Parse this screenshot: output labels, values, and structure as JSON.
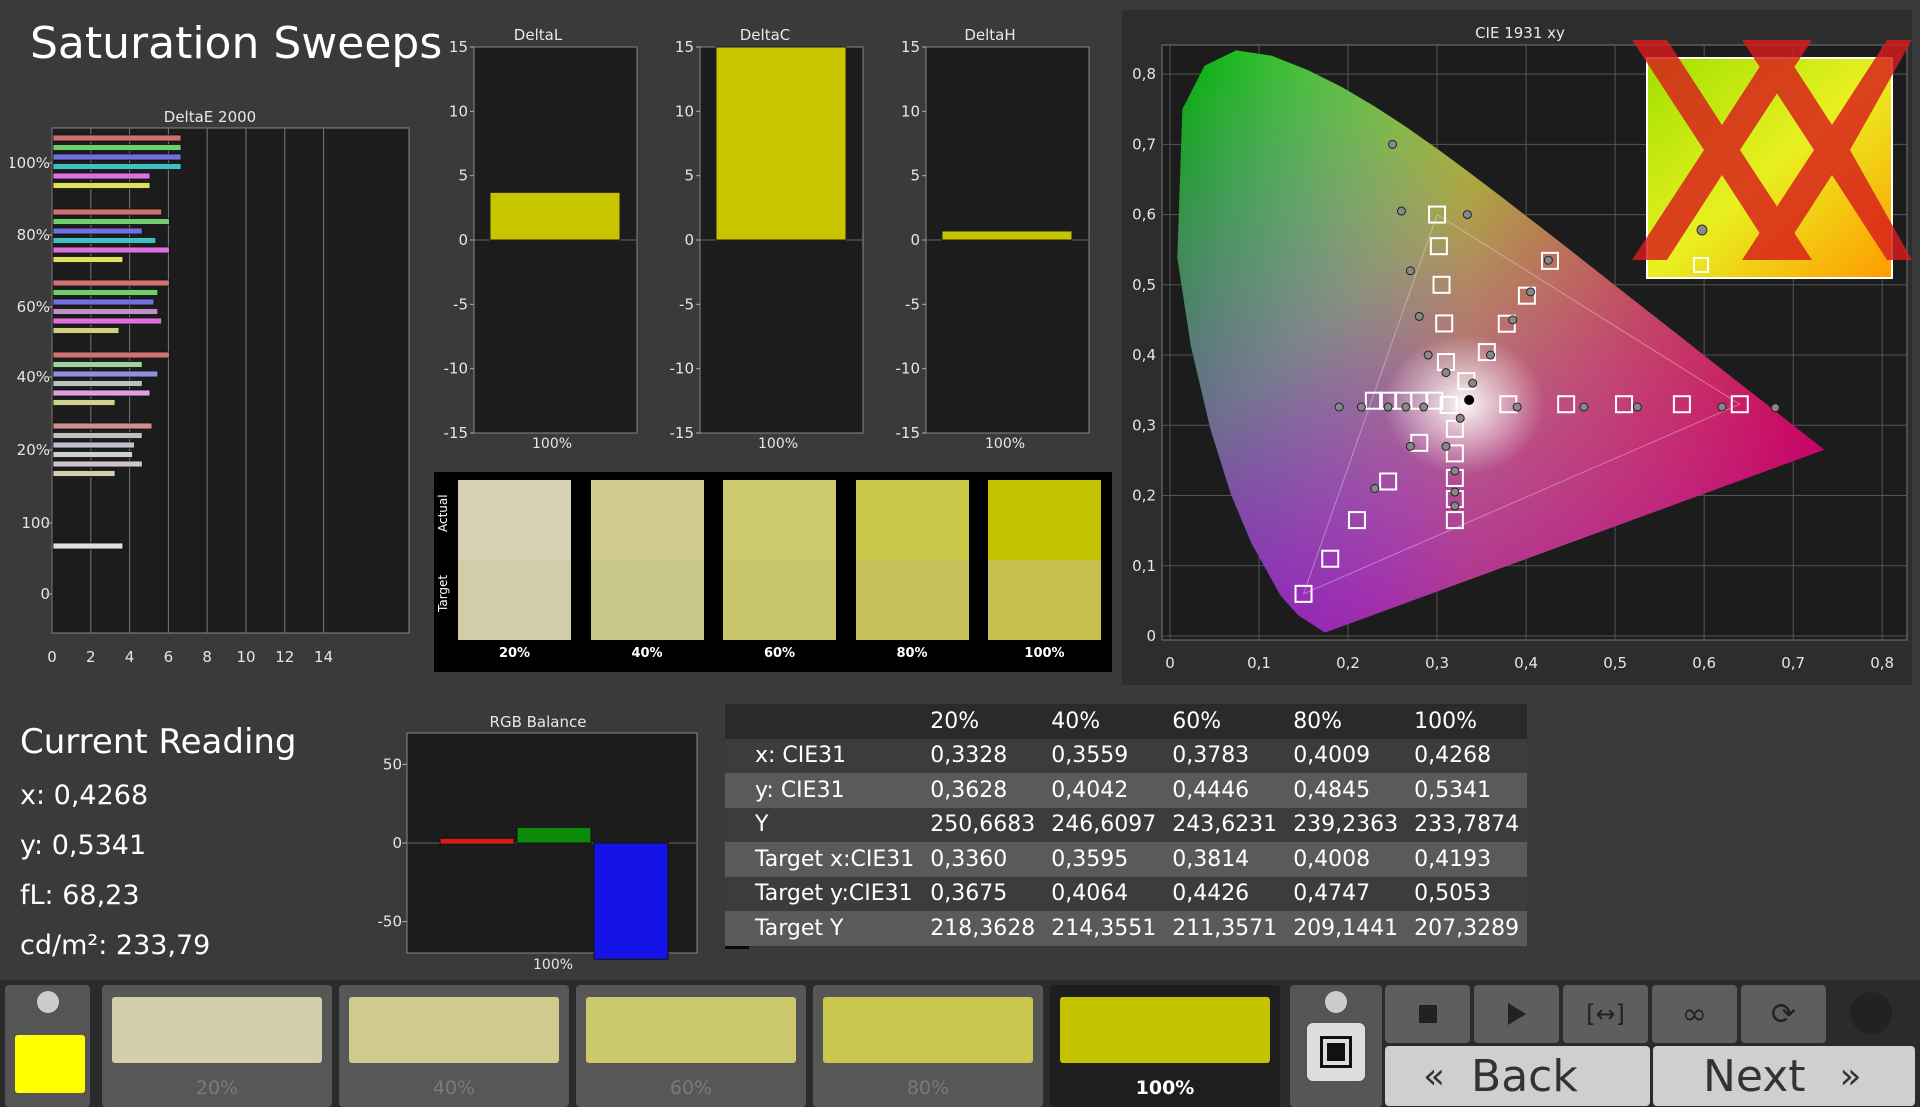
{
  "page_title": "Saturation Sweeps",
  "colors": {
    "accent": "#c8c400",
    "actual_100": "#c3c300",
    "red": "#d81a1a",
    "green": "#0c8a0c",
    "blue": "#1414e6"
  },
  "deltaE": {
    "title": "DeltaE 2000",
    "x_ticks": [
      "0",
      "2",
      "4",
      "6",
      "8",
      "10",
      "12",
      "14"
    ],
    "y_labels": [
      "100%",
      "80%",
      "60%",
      "40%",
      "20%",
      "100",
      "0"
    ]
  },
  "deltaL": {
    "title": "DeltaL",
    "value": 3.7,
    "caption": "100%"
  },
  "deltaC": {
    "title": "DeltaC",
    "value": 15,
    "caption": "100%"
  },
  "deltaH": {
    "title": "DeltaH",
    "value": 0.7,
    "caption": "100%"
  },
  "delta_ticks": [
    "15",
    "10",
    "5",
    "0",
    "-5",
    "-10",
    "-15"
  ],
  "swatches": {
    "actual_label": "Actual",
    "target_label": "Target",
    "items": [
      {
        "label": "20%",
        "actual": "#d4d2b1",
        "target": "#d0cdaa"
      },
      {
        "label": "40%",
        "actual": "#d0cc8f",
        "target": "#cbc88c"
      },
      {
        "label": "60%",
        "actual": "#ccc96e",
        "target": "#c9c46e"
      },
      {
        "label": "80%",
        "actual": "#c9c84a",
        "target": "#c7c259"
      },
      {
        "label": "100%",
        "actual": "#c3c300",
        "target": "#c6c050"
      }
    ]
  },
  "cie": {
    "title": "CIE 1931 xy",
    "x_ticks": [
      "0",
      "0,1",
      "0,2",
      "0,3",
      "0,4",
      "0,5",
      "0,6",
      "0,7",
      "0,8"
    ],
    "y_ticks": [
      "0",
      "0,1",
      "0,2",
      "0,3",
      "0,4",
      "0,5",
      "0,6",
      "0,7",
      "0,8"
    ]
  },
  "reading": {
    "title": "Current Reading",
    "x": "x: 0,4268",
    "y": "y: 0,5341",
    "fl": "fL: 68,23",
    "cd": "cd/m²: 233,79"
  },
  "rgb_balance": {
    "title": "RGB Balance",
    "caption": "100%",
    "ticks": [
      "50",
      "0",
      "-50"
    ],
    "red": 3,
    "green": 10,
    "blue": -74
  },
  "table": {
    "headers": [
      "",
      "20%",
      "40%",
      "60%",
      "80%",
      "100%"
    ],
    "rows": [
      {
        "label": "x: CIE31",
        "values": [
          "0,3328",
          "0,3559",
          "0,3783",
          "0,4009",
          "0,4268"
        ]
      },
      {
        "label": "y: CIE31",
        "values": [
          "0,3628",
          "0,4042",
          "0,4446",
          "0,4845",
          "0,5341"
        ]
      },
      {
        "label": "Y",
        "values": [
          "250,6683",
          "246,6097",
          "243,6231",
          "239,2363",
          "233,7874"
        ]
      },
      {
        "label": "Target x:CIE31",
        "values": [
          "0,3360",
          "0,3595",
          "0,3814",
          "0,4008",
          "0,4193"
        ]
      },
      {
        "label": "Target y:CIE31",
        "values": [
          "0,3675",
          "0,4064",
          "0,4426",
          "0,4747",
          "0,5053"
        ]
      },
      {
        "label": "Target Y",
        "values": [
          "218,3628",
          "214,3551",
          "211,3571",
          "209,1441",
          "207,3289"
        ]
      }
    ]
  },
  "bottom": {
    "buttons": [
      {
        "label": "20%",
        "color": "#d2cfac"
      },
      {
        "label": "40%",
        "color": "#cfcb8c"
      },
      {
        "label": "60%",
        "color": "#ccc86c"
      },
      {
        "label": "80%",
        "color": "#c9c64d"
      },
      {
        "label": "100%",
        "color": "#c3c300"
      }
    ],
    "back_label": "Back",
    "next_label": "Next"
  }
}
